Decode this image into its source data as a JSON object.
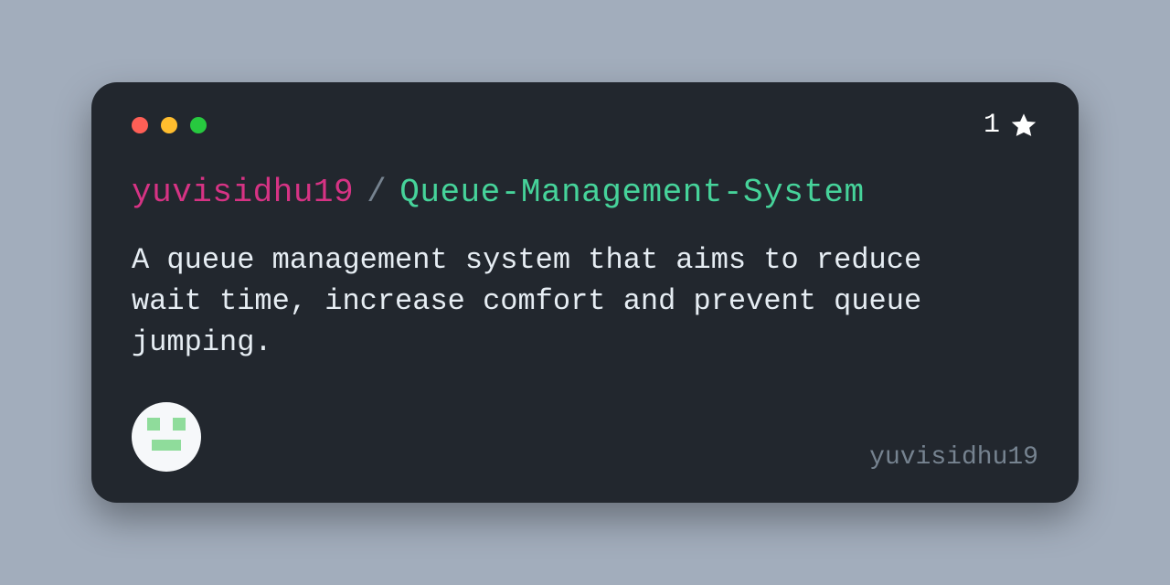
{
  "owner": "yuvisidhu19",
  "slash": "/",
  "repo": "Queue-Management-System",
  "description": "A queue management system that aims to reduce wait time, increase comfort and prevent queue jumping.",
  "stars": "1",
  "handle": "yuvisidhu19",
  "colors": {
    "page_bg": "#a2adbc",
    "card_bg": "#22272e",
    "owner": "#d63384",
    "repo": "#46d39a",
    "muted": "#768390"
  }
}
